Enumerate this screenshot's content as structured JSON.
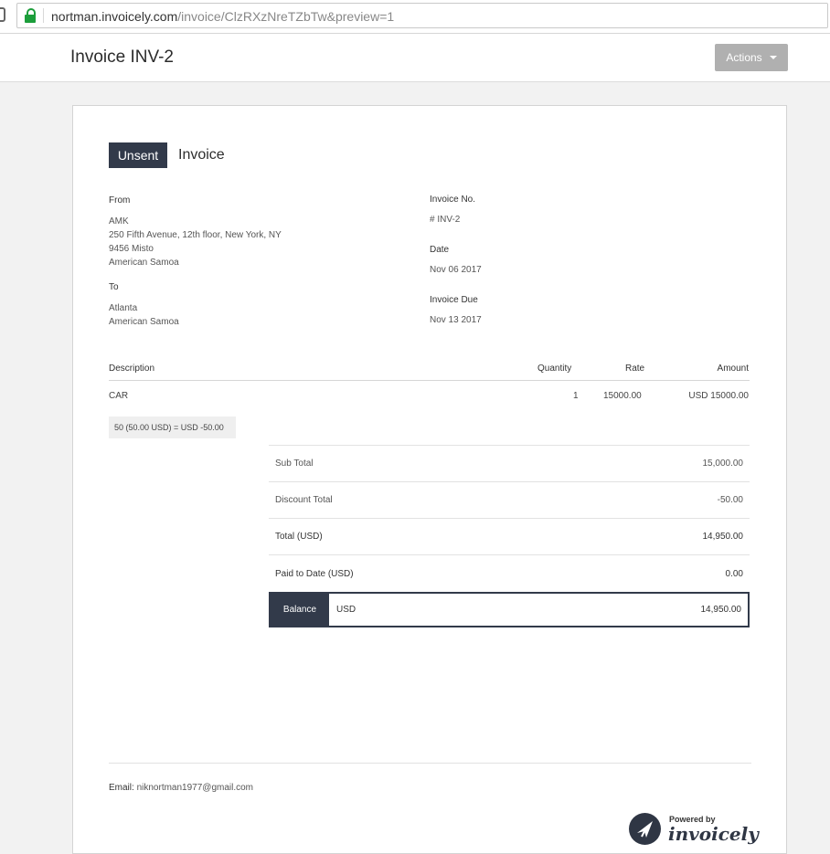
{
  "browser": {
    "url_host": "nortman.invoicely.com",
    "url_path": "/invoice/ClzRXzNreTZbTw&preview=1"
  },
  "header": {
    "title": "Invoice INV-2",
    "actions_label": "Actions"
  },
  "invoice": {
    "status": "Unsent",
    "doc_type": "Invoice",
    "from": {
      "label": "From",
      "lines": [
        "AMK",
        "250 Fifth Avenue, 12th floor, New York, NY",
        "9456 Misto",
        "American Samoa"
      ]
    },
    "to": {
      "label": "To",
      "lines": [
        "Atlanta",
        "American Samoa"
      ]
    },
    "invoice_no": {
      "label": "Invoice No.",
      "value": "# INV-2"
    },
    "date": {
      "label": "Date",
      "value": "Nov 06 2017"
    },
    "due": {
      "label": "Invoice Due",
      "value": "Nov 13 2017"
    },
    "table": {
      "headers": {
        "description": "Description",
        "quantity": "Quantity",
        "rate": "Rate",
        "amount": "Amount"
      },
      "rows": [
        {
          "description": "CAR",
          "quantity": "1",
          "rate": "15000.00",
          "amount": "USD 15000.00"
        }
      ],
      "discount_note": "50 (50.00 USD) = USD -50.00"
    },
    "summary": [
      {
        "label": "Sub Total",
        "value": "15,000.00"
      },
      {
        "label": "Discount Total",
        "value": "-50.00"
      },
      {
        "label": "Total (USD)",
        "value": "14,950.00"
      },
      {
        "label": "Paid to Date (USD)",
        "value": "0.00"
      }
    ],
    "balance": {
      "label": "Balance",
      "currency": "USD",
      "value": "14,950.00"
    },
    "footer": {
      "email_label": "Email:",
      "email": "niknortman1977@gmail.com"
    },
    "powered": {
      "by": "Powered by",
      "brand": "invoicely"
    }
  },
  "colors": {
    "dark": "#323a4a",
    "lock": "#1c9e3b",
    "button": "#b0b0b0"
  },
  "icons": [
    "lock-icon",
    "caret-down-icon",
    "invoicely-logo-icon"
  ]
}
